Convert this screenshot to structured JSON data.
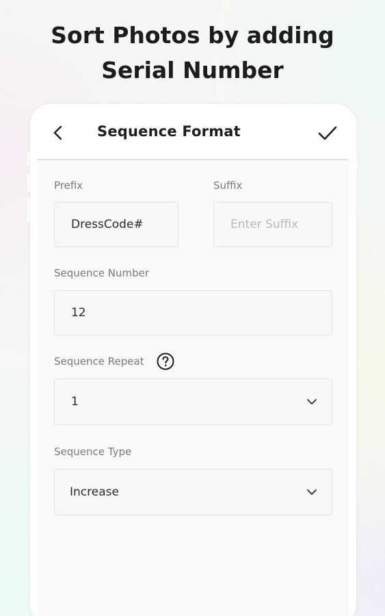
{
  "promo": {
    "line1": "Sort Photos by adding",
    "line2": "Serial Number"
  },
  "app_bar": {
    "title": "Sequence Format",
    "back_icon": "chevron-left-icon",
    "confirm_icon": "checkmark-icon"
  },
  "form": {
    "prefix": {
      "label": "Prefix",
      "value": "DressCode#"
    },
    "suffix": {
      "label": "Suffix",
      "value": "",
      "placeholder": "Enter Suffix"
    },
    "sequence_number": {
      "label": "Sequence Number",
      "value": "12"
    },
    "sequence_repeat": {
      "label": "Sequence Repeat",
      "value": "1",
      "help_icon": "question-circle-icon"
    },
    "sequence_type": {
      "label": "Sequence Type",
      "value": "Increase"
    }
  },
  "colors": {
    "text_dark": "#1e1e1e",
    "label_gray": "#7a7a7a",
    "field_border": "#e4e4e4",
    "placeholder": "#b9b9b9"
  }
}
